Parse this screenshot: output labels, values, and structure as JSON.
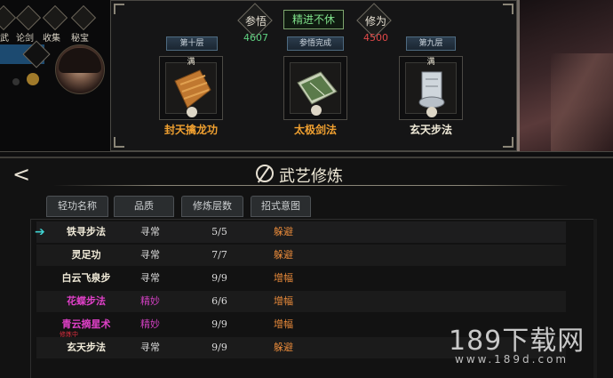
{
  "top_menu": {
    "items": [
      {
        "label": "武"
      },
      {
        "label": "论剑"
      },
      {
        "label": "收集"
      },
      {
        "label": "秘宝"
      }
    ]
  },
  "upper_panel": {
    "insight_label": "参悟",
    "insight_value": "4607",
    "status_label": "精进不休",
    "cultivation_label": "修为",
    "cultivation_value": "4500",
    "cards": [
      {
        "tag": "第十层",
        "full": "满",
        "name": "封天擒龙功",
        "name_color": "#f0a030"
      },
      {
        "tag": "参悟完成",
        "full": "",
        "name": "太极剑法",
        "name_color": "#f0a030"
      },
      {
        "tag": "第九层",
        "full": "满",
        "name": "玄天步法",
        "name_color": "#f0ead8"
      }
    ]
  },
  "lower_panel": {
    "back_glyph": "<",
    "title": "武艺修炼",
    "tabs": [
      "轻功名称",
      "品质",
      "修炼层数",
      "招式意图"
    ],
    "rows": [
      {
        "name": "铁寻步法",
        "quality": "寻常",
        "level": "5/5",
        "effect": "躲避",
        "name_color": "#f0ead8",
        "quality_color": "#d8d8d8",
        "selected": true
      },
      {
        "name": "灵足功",
        "quality": "寻常",
        "level": "7/7",
        "effect": "躲避",
        "name_color": "#f0ead8",
        "quality_color": "#d8d8d8"
      },
      {
        "name": "白云飞泉步",
        "quality": "寻常",
        "level": "9/9",
        "effect": "增幅",
        "name_color": "#f0ead8",
        "quality_color": "#d8d8d8"
      },
      {
        "name": "花蝶步法",
        "quality": "精妙",
        "level": "6/6",
        "effect": "增幅",
        "name_color": "#e040c8",
        "quality_color": "#d040c0"
      },
      {
        "name": "青云摘星术",
        "quality": "精妙",
        "level": "9/9",
        "effect": "增幅",
        "name_color": "#e040c8",
        "quality_color": "#d040c0"
      },
      {
        "name": "玄天步法",
        "quality": "寻常",
        "level": "9/9",
        "effect": "躲避",
        "name_color": "#f0ead8",
        "quality_color": "#d8d8d8",
        "badge": "修炼中"
      }
    ]
  },
  "watermark": {
    "main": "189下载网",
    "sub": "www.189d.com"
  },
  "colors": {
    "insight": "#5fd080",
    "cultivation": "#e04848",
    "effect": "#e88a3a"
  }
}
